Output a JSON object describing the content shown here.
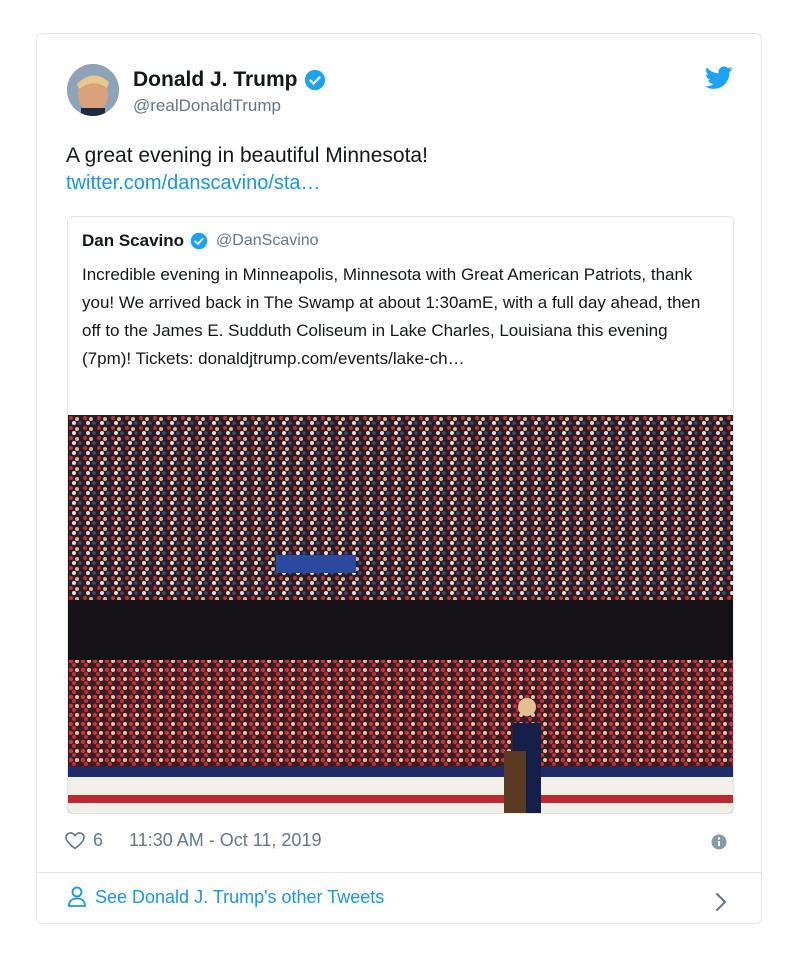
{
  "tweet": {
    "author_name": "Donald J. Trump",
    "author_handle": "@realDonaldTrump",
    "text": "A great evening in beautiful Minnesota!",
    "link": "twitter.com/danscavino/sta…",
    "likes": "6",
    "timestamp": "11:30 AM - Oct 11, 2019"
  },
  "quoted": {
    "author_name": "Dan Scavino",
    "author_handle": "@DanScavino",
    "text": "Incredible evening in Minneapolis, Minnesota with Great American Patriots, thank you! We arrived back in The Swamp at about 1:30amE, with a full day ahead, then off to the James E. Sudduth Coliseum in Lake Charles, Louisiana this evening (7pm)! Tickets: donaldjtrump.com/events/lake-ch…"
  },
  "footer": {
    "see_more": "See Donald J. Trump's other Tweets"
  },
  "icons": {
    "verified": "verified-badge-icon",
    "twitter": "twitter-bird-icon",
    "heart": "heart-icon",
    "info": "info-icon",
    "person": "person-icon",
    "chevron": "chevron-right-icon"
  },
  "colors": {
    "link": "#1b95e0",
    "muted": "#657786",
    "border": "#e1e8ed",
    "verified": "#1da1f2"
  }
}
